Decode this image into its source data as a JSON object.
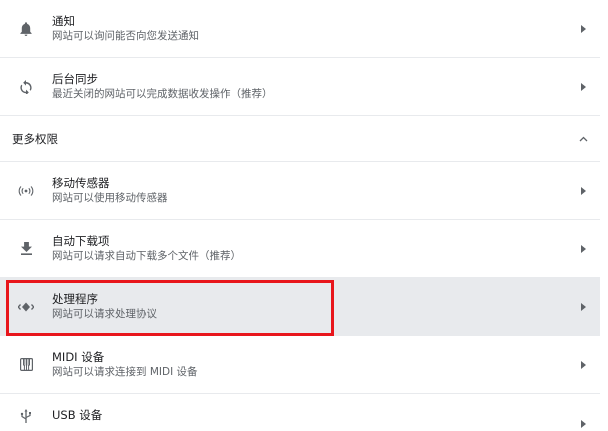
{
  "permissions": [
    {
      "icon": "bell-icon",
      "title": "通知",
      "subtitle": "网站可以询问能否向您发送通知"
    },
    {
      "icon": "sync-icon",
      "title": "后台同步",
      "subtitle": "最近关闭的网站可以完成数据收发操作（推荐）"
    }
  ],
  "more_section": {
    "label": "更多权限",
    "expanded": true
  },
  "more_permissions": [
    {
      "icon": "motion-sensor-icon",
      "title": "移动传感器",
      "subtitle": "网站可以使用移动传感器"
    },
    {
      "icon": "download-icon",
      "title": "自动下载项",
      "subtitle": "网站可以请求自动下载多个文件（推荐）"
    },
    {
      "icon": "handler-icon",
      "title": "处理程序",
      "subtitle": "网站可以请求处理协议",
      "highlighted": true
    },
    {
      "icon": "piano-icon",
      "title": "MIDI 设备",
      "subtitle": "网站可以请求连接到 MIDI 设备"
    },
    {
      "icon": "usb-icon",
      "title": "USB 设备",
      "subtitle": ""
    }
  ],
  "colors": {
    "highlight_row": "#e8eaed",
    "annotation_box": "#e8161c",
    "icon": "#5f6368"
  }
}
